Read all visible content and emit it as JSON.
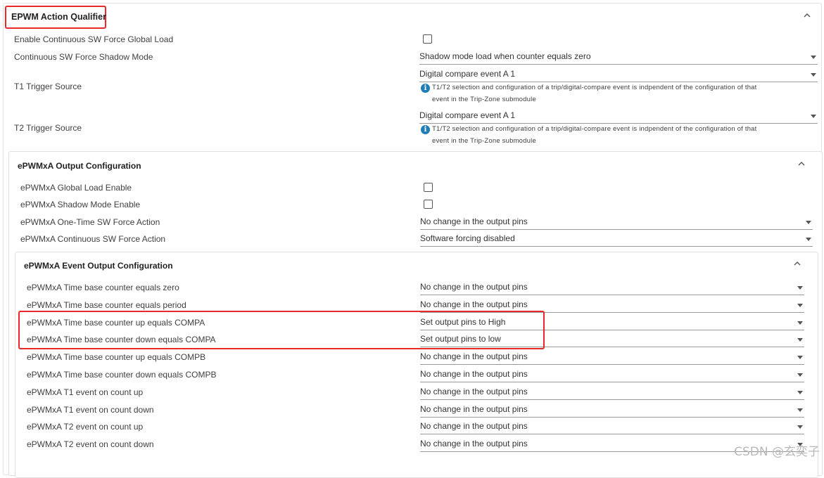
{
  "action_qualifier": {
    "title": "EPWM Action Qualifier",
    "enable_continuous_sw_force_global_load": {
      "label": "Enable Continuous SW Force Global Load",
      "checked": false
    },
    "continuous_sw_force_shadow_mode": {
      "label": "Continuous SW Force Shadow Mode",
      "value": "Shadow mode load when counter equals zero"
    },
    "t1_trigger_source": {
      "label": "T1 Trigger Source",
      "value": "Digital compare event A 1",
      "info_line1": "T1/T2 selection and configuration of a trip/digital-compare event is indpendent of the configuration of that",
      "info_line2": "event in the Trip-Zone submodule"
    },
    "t2_trigger_source": {
      "label": "T2 Trigger Source",
      "value": "Digital compare event A 1",
      "info_line1": "T1/T2 selection and configuration of a trip/digital-compare event is indpendent of the configuration of that",
      "info_line2": "event in the Trip-Zone submodule"
    }
  },
  "output_config": {
    "title": "ePWMxA Output Configuration",
    "global_load_enable": {
      "label": "ePWMxA Global Load Enable",
      "checked": false
    },
    "shadow_mode_enable": {
      "label": "ePWMxA Shadow Mode Enable",
      "checked": false
    },
    "one_time_sw_force_action": {
      "label": "ePWMxA One-Time SW Force Action",
      "value": "No change in the output pins"
    },
    "continuous_sw_force_action": {
      "label": "ePWMxA Continuous SW Force Action",
      "value": "Software forcing disabled"
    }
  },
  "event_output_config": {
    "title": "ePWMxA Event Output Configuration",
    "rows": [
      {
        "label": "ePWMxA Time base counter equals zero",
        "value": "No change in the output pins"
      },
      {
        "label": "ePWMxA Time base counter equals period",
        "value": "No change in the output pins"
      },
      {
        "label": "ePWMxA Time base counter up equals COMPA",
        "value": "Set output pins to High"
      },
      {
        "label": "ePWMxA Time base counter down equals COMPA",
        "value": "Set output pins to low"
      },
      {
        "label": "ePWMxA Time base counter up equals COMPB",
        "value": "No change in the output pins"
      },
      {
        "label": "ePWMxA Time base counter down equals COMPB",
        "value": "No change in the output pins"
      },
      {
        "label": "ePWMxA T1 event on count up",
        "value": "No change in the output pins"
      },
      {
        "label": "ePWMxA T1 event on count down",
        "value": "No change in the output pins"
      },
      {
        "label": "ePWMxA T2 event on count up",
        "value": "No change in the output pins"
      },
      {
        "label": "ePWMxA T2 event on count down",
        "value": "No change in the output pins"
      }
    ]
  },
  "watermark": "CSDN @玄奕子",
  "colors": {
    "highlight": "#e8282a",
    "info_icon": "#1f7db8"
  },
  "icons": {
    "collapse": "chevron-up-icon",
    "dropdown": "caret-down-icon",
    "info": "info-icon"
  }
}
